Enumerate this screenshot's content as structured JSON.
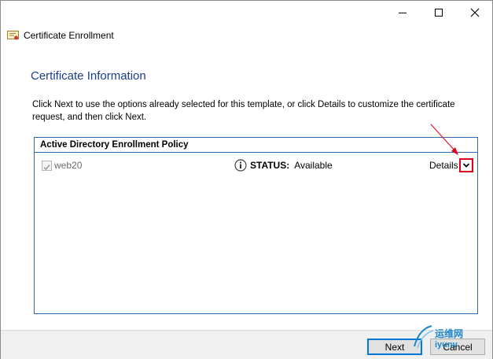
{
  "window": {
    "title": "Certificate Enrollment",
    "icons": {
      "app": "certificate-icon",
      "minimize": "minimize-icon",
      "maximize": "maximize-icon",
      "close": "close-icon"
    }
  },
  "page": {
    "heading": "Certificate Information",
    "description": "Click Next to use the options already selected for this template, or click Details to customize the certificate request, and then click Next."
  },
  "policy": {
    "header": "Active Directory Enrollment Policy",
    "items": [
      {
        "name": "web20",
        "checked": true,
        "status_label": "STATUS:",
        "status_value": "Available",
        "details_label": "Details",
        "icons": {
          "status": "info-icon",
          "expand": "chevron-down-icon"
        }
      }
    ]
  },
  "footer": {
    "next_label": "Next",
    "cancel_label": "Cancel"
  },
  "watermark": {
    "text": "运维网",
    "subtext": "iyunv"
  },
  "colors": {
    "heading": "#1a3e8c",
    "panel_border": "#2f6aa8",
    "highlight": "#e0001b",
    "primary_button_border": "#0078d7"
  }
}
